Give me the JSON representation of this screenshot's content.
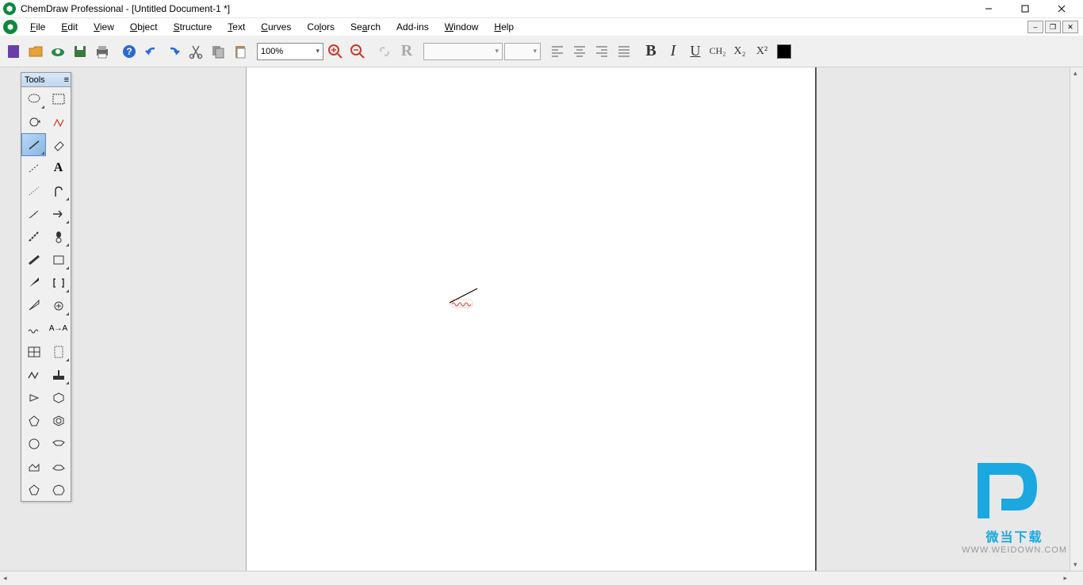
{
  "title": "ChemDraw Professional - [Untitled Document-1 *]",
  "menus": [
    "File",
    "Edit",
    "View",
    "Object",
    "Structure",
    "Text",
    "Curves",
    "Colors",
    "Search",
    "Add-ins",
    "Window",
    "Help"
  ],
  "toolbar": {
    "zoom": "100%",
    "bold": "B",
    "italic": "I",
    "underline": "U",
    "formula": "CH₂",
    "subscript": "X₂",
    "superscript": "X²"
  },
  "tools": {
    "header": "Tools",
    "selected_index": 4
  },
  "watermark": {
    "text": "微当下载",
    "url": "WWW.WEIDOWN.COM"
  }
}
